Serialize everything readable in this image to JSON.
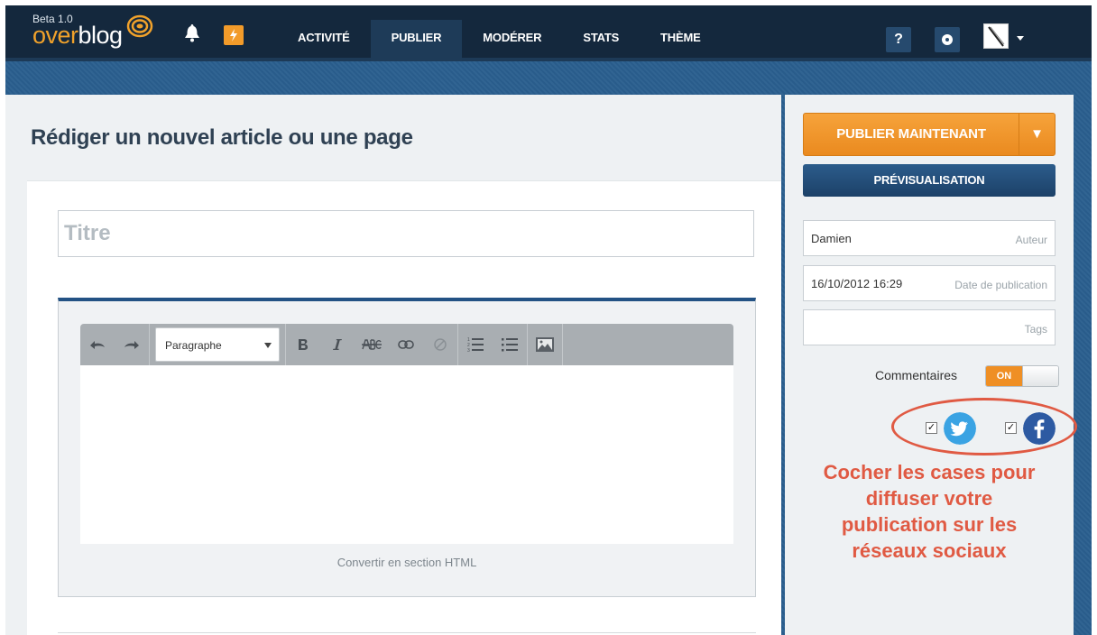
{
  "app": {
    "version_label": "Beta 1.0",
    "logo_over": "over",
    "logo_blog": "blog"
  },
  "nav": {
    "items": [
      {
        "label": "ACTIVITÉ",
        "active": false
      },
      {
        "label": "PUBLIER",
        "active": true
      },
      {
        "label": "MODÉRER",
        "active": false
      },
      {
        "label": "STATS",
        "active": false
      },
      {
        "label": "THÈME",
        "active": false
      }
    ],
    "help_label": "?"
  },
  "main": {
    "page_title": "Rédiger un nouvel article ou une page",
    "title_placeholder": "Titre",
    "title_value": "",
    "format_select_value": "Paragraphe",
    "convert_label": "Convertir en section HTML"
  },
  "sidebar": {
    "publish_label": "PUBLIER MAINTENANT",
    "publish_split_glyph": "▼",
    "preview_label": "PRÉVISUALISATION",
    "author_value": "Damien",
    "author_label": "Auteur",
    "date_value": "16/10/2012 16:29",
    "date_label": "Date de publication",
    "tags_value": "",
    "tags_label": "Tags",
    "comments_label": "Commentaires",
    "comments_toggle": "ON",
    "twitter_checked": true,
    "facebook_checked": true,
    "checkmark_glyph": "✓"
  },
  "annotation": {
    "line1": "Cocher les cases pour",
    "line2": "diffuser votre",
    "line3": "publication sur les",
    "line4": "réseaux sociaux"
  },
  "colors": {
    "topbar": "#14283d",
    "background": "#2a5f8f",
    "accent_orange": "#ef8f24",
    "preview_blue": "#1c4168",
    "annotation_red": "#e05a43",
    "twitter": "#3aa3e3",
    "facebook": "#2d5aa2"
  },
  "icons": [
    "bell-icon",
    "bolt-icon",
    "gear-icon",
    "undo-icon",
    "redo-icon",
    "bold-icon",
    "italic-icon",
    "strikethrough-icon",
    "link-icon",
    "unlink-icon",
    "ordered-list-icon",
    "unordered-list-icon",
    "image-icon",
    "twitter-icon",
    "facebook-icon"
  ]
}
